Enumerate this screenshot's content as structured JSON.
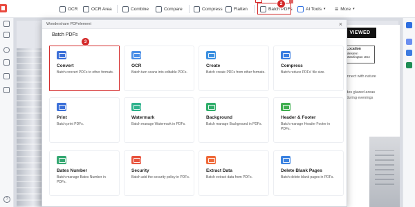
{
  "toolbar": {
    "items": [
      {
        "label": "OCR",
        "icon": "ocr-icon"
      },
      {
        "label": "OCR Area",
        "icon": "ocr-area-icon"
      },
      {
        "label": "Combine",
        "icon": "combine-icon"
      },
      {
        "label": "Compare",
        "icon": "compare-icon"
      },
      {
        "label": "Compress",
        "icon": "compress-icon"
      },
      {
        "label": "Flatten",
        "icon": "flatten-icon"
      },
      {
        "label": "Batch PDFs",
        "icon": "batch-pdfs-icon"
      },
      {
        "label": "AI Tools",
        "icon": "ai-tools-icon"
      },
      {
        "label": "More",
        "icon": "more-icon"
      }
    ]
  },
  "annotations": {
    "step_batch": "2",
    "step_convert": "3"
  },
  "dialog": {
    "window_title": "Wondershare PDFelement",
    "heading": "Batch PDFs",
    "close_symbol": "×",
    "cards": [
      {
        "title": "Convert",
        "desc": "Batch convert PDFs to other formats.",
        "icon": "convert-icon",
        "color": "#3b6fd8"
      },
      {
        "title": "OCR",
        "desc": "Batch turn scans into editable PDFs.",
        "icon": "ocr-icon",
        "color": "#4a8ee6"
      },
      {
        "title": "Create",
        "desc": "Batch create PDFs from other formats.",
        "icon": "folder-icon",
        "color": "#3b8fe0"
      },
      {
        "title": "Compress",
        "desc": "Batch reduce PDFs' file size.",
        "icon": "compress-icon",
        "color": "#3a7de0"
      },
      {
        "title": "Print",
        "desc": "Batch print PDFs.",
        "icon": "printer-icon",
        "color": "#3b6fd8"
      },
      {
        "title": "Watermark",
        "desc": "Batch manage Watermark in PDFs.",
        "icon": "watermark-icon",
        "color": "#2fb38d"
      },
      {
        "title": "Background",
        "desc": "Batch manage Background in PDFs.",
        "icon": "background-icon",
        "color": "#2fae6a"
      },
      {
        "title": "Header & Footer",
        "desc": "Batch manage Header Footer in PDFs.",
        "icon": "header-footer-icon",
        "color": "#3fae4f"
      },
      {
        "title": "Bates Number",
        "desc": "Batch manage Bates Number in PDFs.",
        "icon": "bates-number-icon",
        "color": "#35a872"
      },
      {
        "title": "Security",
        "desc": "Batch add the security policy in PDFs.",
        "icon": "shield-icon",
        "color": "#e8543e"
      },
      {
        "title": "Extract Data",
        "desc": "Batch extract data from PDFs.",
        "icon": "extract-data-icon",
        "color": "#ef6a3a"
      },
      {
        "title": "Delete Blank Pages",
        "desc": "Batch delete blank pages in PDFs.",
        "icon": "delete-pages-icon",
        "color": "#3b82e0"
      }
    ]
  },
  "background_doc": {
    "brand_text": "VIEWED",
    "location_title": "Location",
    "location_lines": [
      "Western",
      "Washington USA"
    ],
    "para1": "connect with nature",
    "para2_lines": [
      "ludes glazed areas",
      "n during evenings"
    ]
  },
  "rail": {
    "help": "?"
  },
  "colors": {
    "highlight": "#d42a2a",
    "accent": "#2f6fe0"
  }
}
